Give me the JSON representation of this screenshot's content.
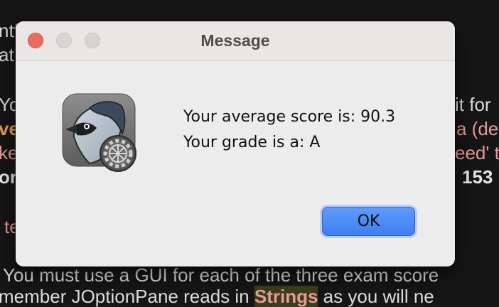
{
  "background_document": {
    "line1": "ntf",
    "line2": "at",
    "line3_left": "Yo",
    "line3_right": "it for",
    "line4_left": "ve",
    "line4_right": "a (de",
    "line5_left": "ke",
    "line5_right": "eed' th",
    "line6_left": "or",
    "line6_right": "153",
    "line7": "te",
    "line8": "You must use a GUI for each of the three exam score",
    "line9_left": "member JOptionPane reads in",
    "line9_highlight": "Strings",
    "line9_right": "as you will ne"
  },
  "dialog": {
    "title": "Message",
    "messages": [
      "Your average score is: 90.3",
      "Your grade is a: A"
    ],
    "ok_label": "OK",
    "app_icon": "bluej-icon"
  },
  "colors": {
    "close": "#ed6a5e",
    "button_accent": "#4a8af5",
    "dialog_background": "#ececec"
  }
}
